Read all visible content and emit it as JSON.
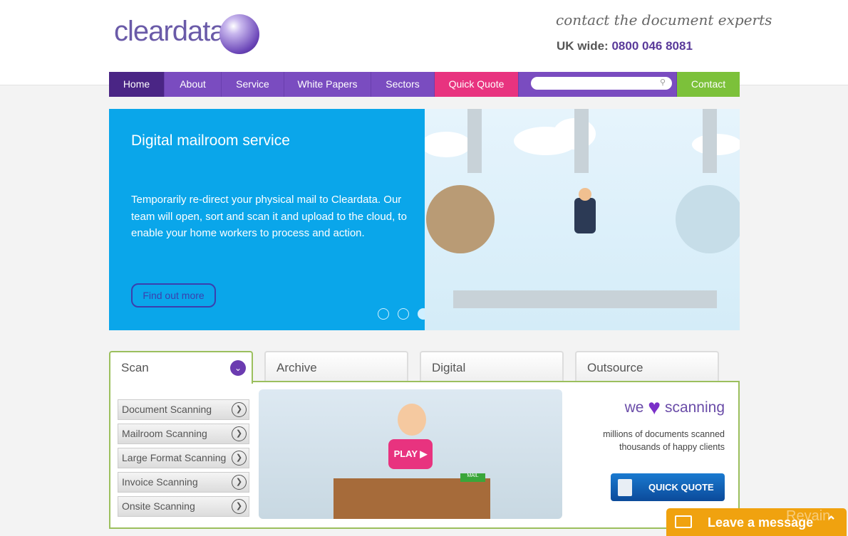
{
  "header": {
    "logo": "cleardata",
    "tagline": "contact the document experts",
    "phone_label": "UK wide:",
    "phone": "0800 046 8081"
  },
  "nav": {
    "items": [
      "Home",
      "About",
      "Service",
      "White Papers",
      "Sectors",
      "Quick Quote"
    ],
    "contact": "Contact",
    "search_placeholder": ""
  },
  "hero": {
    "title": "Digital mailroom service",
    "text": "Temporarily re-direct your physical mail to Cleardata. Our team will open, sort and scan it and upload to the cloud, to enable your home workers to process and action.",
    "button": "Find out more",
    "active_slide": 3,
    "slides": 3
  },
  "tabs": [
    "Scan",
    "Archive",
    "Digital",
    "Outsource"
  ],
  "scan_links": [
    "Document Scanning",
    "Mailroom Scanning",
    "Large Format Scanning",
    "Invoice Scanning",
    "Onsite Scanning"
  ],
  "video": {
    "play": "PLAY",
    "sign": "MAIL"
  },
  "promo": {
    "we": "we",
    "scanning": "scanning",
    "line1": "millions of documents scanned",
    "line2": "thousands of happy clients",
    "button": "QUICK QUOTE"
  },
  "chat": {
    "label": "Leave a message",
    "watermark": "Revain"
  },
  "colors": {
    "purple": "#7a4cc0",
    "pink": "#e8337f",
    "green": "#7cc13a",
    "blue": "#0aa6ea",
    "orange": "#f0a20f"
  }
}
